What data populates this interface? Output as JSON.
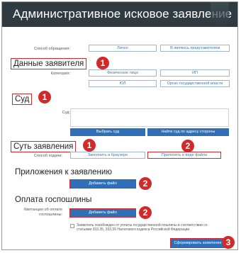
{
  "header": {
    "title": "Административное исковое заявление"
  },
  "contact": {
    "label": "Способ обращения:",
    "options": [
      "Лично",
      "Я являюсь представителем"
    ]
  },
  "applicant": {
    "title": "Данные заявителя",
    "marker": "1",
    "category_label": "Категория:",
    "options": [
      "Физическое лицо",
      "ИП",
      "ЮЛ",
      "Орган государственной власти"
    ]
  },
  "court": {
    "title": "Суд",
    "marker": "1",
    "label": "Суд:",
    "select_button": "Выбрать суд",
    "find_button": "Найти суд по адресу стороны"
  },
  "essence": {
    "title": "Суть заявления",
    "marker": "1",
    "method_label": "Способ подачи:",
    "browser_option": "Заполнить в браузере",
    "file_option": "Прилохить в виде файла",
    "file_marker": "2"
  },
  "attachments": {
    "title": "Приложения к заявлению",
    "add_button": "Добавить файл",
    "marker": "2"
  },
  "fee": {
    "title": "Оплата госпошлины",
    "receipt_label_1": "Квитанция об оплате",
    "receipt_label_2": "госпошлины:",
    "add_button": "Добавить файл",
    "marker": "2",
    "exempt_text_1": "Заявитель освобожден от уплаты государственной пошлины в соответствии со",
    "exempt_text_2": "статьями 333.35, 333.36 Налогового кодекса Российской Федерации"
  },
  "submit": {
    "button": "Сформировать заявление",
    "marker": "3"
  },
  "colors": {
    "accent": "#2e6fb7",
    "annotation": "#d02a2a",
    "header": "#2f3a41"
  }
}
